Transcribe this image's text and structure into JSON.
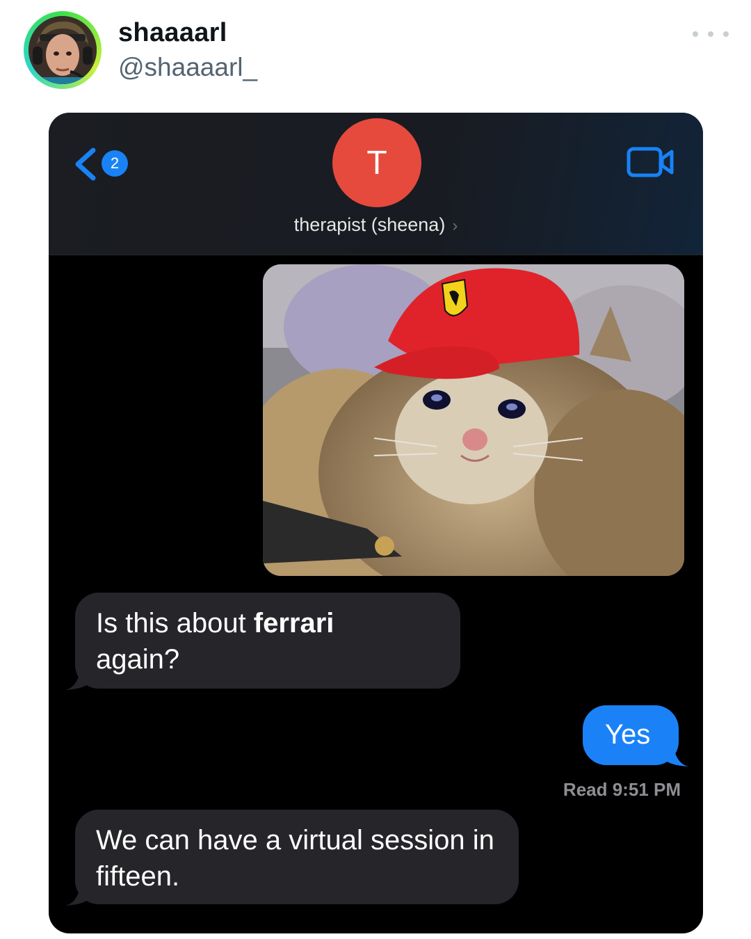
{
  "post": {
    "author_name": "shaaaarl",
    "author_handle": "@shaaaarl_"
  },
  "chat": {
    "back_badge_count": "2",
    "contact_initial": "T",
    "contact_name": "therapist (sheena)",
    "contact_chevron": "›",
    "messages": [
      {
        "direction": "incoming",
        "text_before": "Is this about ",
        "text_bold": "ferrari",
        "text_after": "again?"
      },
      {
        "direction": "outgoing",
        "text": "Yes"
      },
      {
        "direction": "incoming",
        "text": "We can have a virtual session in fifteen."
      }
    ],
    "read_receipt": "Read 9:51 PM"
  },
  "icons": {
    "more": "more-horizontal-icon",
    "back": "chevron-left-icon",
    "video": "video-camera-icon"
  },
  "colors": {
    "imessage_blue": "#1a82f6",
    "incoming_bubble": "#26252a",
    "contact_avatar": "#e54a3d",
    "link_blue": "#1982f5"
  }
}
